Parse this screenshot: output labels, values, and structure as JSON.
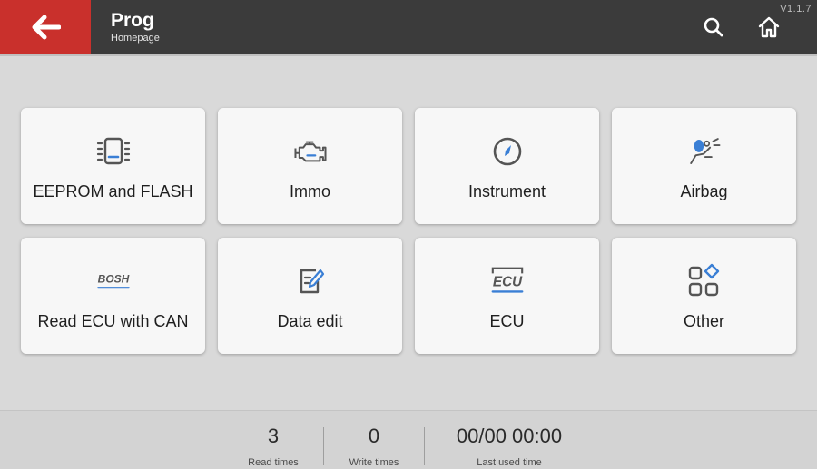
{
  "header": {
    "title": "Prog",
    "subtitle": "Homepage",
    "version": "V1.1.7",
    "back_icon": "arrow-left-icon",
    "search_icon": "search-icon",
    "home_icon": "home-icon"
  },
  "colors": {
    "accent_red": "#c9302c",
    "header_bg": "#3b3b3b",
    "icon_gray": "#555555",
    "icon_blue": "#3a7fd5"
  },
  "menu": {
    "items": [
      {
        "label": "EEPROM and FLASH",
        "icon": "eeprom-chip-icon"
      },
      {
        "label": "Immo",
        "icon": "engine-icon"
      },
      {
        "label": "Instrument",
        "icon": "compass-gauge-icon"
      },
      {
        "label": "Airbag",
        "icon": "airbag-icon"
      },
      {
        "label": "Read ECU with CAN",
        "icon": "bosh-logo-icon",
        "icon_text": "BOSH"
      },
      {
        "label": "Data edit",
        "icon": "edit-document-icon"
      },
      {
        "label": "ECU",
        "icon": "ecu-icon",
        "icon_text": "ECU"
      },
      {
        "label": "Other",
        "icon": "apps-grid-icon"
      }
    ]
  },
  "stats": {
    "read": {
      "value": "3",
      "caption": "Read times"
    },
    "write": {
      "value": "0",
      "caption": "Write times"
    },
    "last": {
      "value": "00/00 00:00",
      "caption": "Last used time"
    }
  }
}
